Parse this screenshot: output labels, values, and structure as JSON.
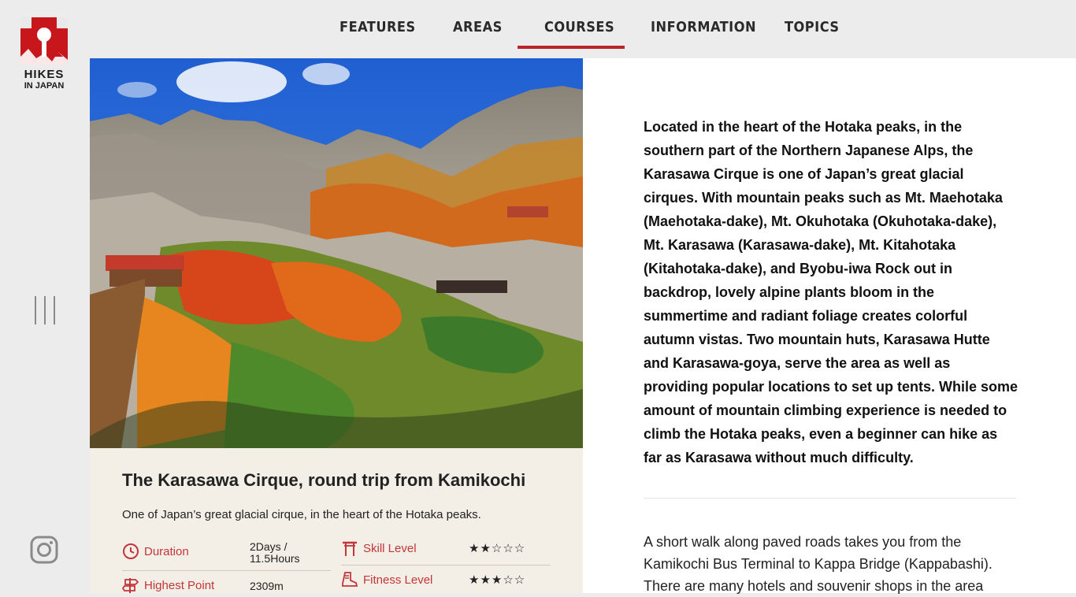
{
  "brand": {
    "name": "HIKES",
    "sub": "IN JAPAN",
    "color": "#c8161d"
  },
  "nav": {
    "items": [
      {
        "label": "FEATURES"
      },
      {
        "label": "AREAS"
      },
      {
        "label": "COURSES"
      },
      {
        "label": "INFORMATION"
      },
      {
        "label": "TOPICS"
      }
    ],
    "active": "COURSES",
    "accent": "#b8262b"
  },
  "sidebar": {
    "menu_icon": "menu-bars-icon",
    "social_icon": "instagram-icon"
  },
  "hero": {
    "image": "mountain-autumn-cirque-photo"
  },
  "course": {
    "title": "The Karasawa Cirque, round trip from Kamikochi",
    "subtitle": "One of Japan’s great glacial cirque, in the heart of the Hotaka peaks.",
    "stats": {
      "duration": {
        "label": "Duration",
        "value_line1": "2Days /",
        "value_line2": "11.5Hours",
        "icon": "clock-icon"
      },
      "highest_point": {
        "label": "Highest Point",
        "value": "2309m",
        "icon": "signpost-icon"
      },
      "skill_level": {
        "label": "Skill Level",
        "rating": 2,
        "max": 5,
        "stars": "★★☆☆☆",
        "icon": "torii-gate-icon"
      },
      "fitness_level": {
        "label": "Fitness Level",
        "rating": 3,
        "max": 5,
        "stars": "★★★☆☆",
        "icon": "boot-icon"
      }
    },
    "label_color": "#c2353a"
  },
  "description": "Located in the heart of the Hotaka peaks, in the southern part of the Northern Japanese Alps, the Karasawa Cirque is one of Japan’s great glacial cirques. With mountain peaks such as Mt. Maehotaka (Maehotaka-dake), Mt. Okuhotaka (Okuhotaka-dake), Mt. Karasawa (Karasawa-dake), Mt. Kitahotaka (Kitahotaka-dake), and Byobu-iwa Rock out in backdrop, lovely alpine plants bloom in the summertime and radiant foliage creates colorful autumn vistas. Two mountain huts, Karasawa Hutte and Karasawa-goya, serve the area as well as providing popular locations to set up tents. While some amount of mountain climbing experience is needed to climb the Hotaka peaks, even a beginner can hike as far as Karasawa without much difficulty.",
  "description2": "A short walk along paved roads takes you from the Kamikochi Bus Terminal to Kappa Bridge (Kappabashi). There are many hotels and souvenir shops in the area"
}
